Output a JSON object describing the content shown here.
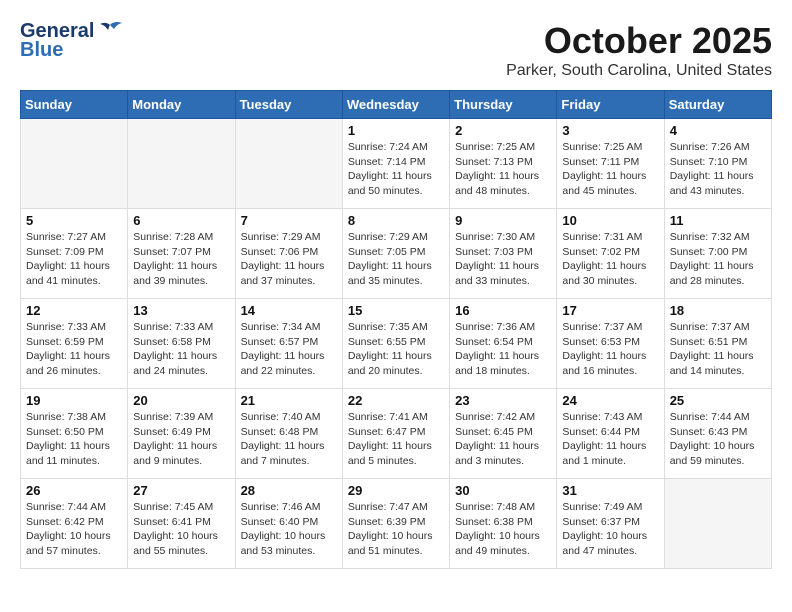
{
  "header": {
    "logo_line1": "General",
    "logo_line2": "Blue",
    "month": "October 2025",
    "location": "Parker, South Carolina, United States"
  },
  "days_of_week": [
    "Sunday",
    "Monday",
    "Tuesday",
    "Wednesday",
    "Thursday",
    "Friday",
    "Saturday"
  ],
  "weeks": [
    [
      {
        "day": "",
        "info": ""
      },
      {
        "day": "",
        "info": ""
      },
      {
        "day": "",
        "info": ""
      },
      {
        "day": "1",
        "info": "Sunrise: 7:24 AM\nSunset: 7:14 PM\nDaylight: 11 hours and 50 minutes."
      },
      {
        "day": "2",
        "info": "Sunrise: 7:25 AM\nSunset: 7:13 PM\nDaylight: 11 hours and 48 minutes."
      },
      {
        "day": "3",
        "info": "Sunrise: 7:25 AM\nSunset: 7:11 PM\nDaylight: 11 hours and 45 minutes."
      },
      {
        "day": "4",
        "info": "Sunrise: 7:26 AM\nSunset: 7:10 PM\nDaylight: 11 hours and 43 minutes."
      }
    ],
    [
      {
        "day": "5",
        "info": "Sunrise: 7:27 AM\nSunset: 7:09 PM\nDaylight: 11 hours and 41 minutes."
      },
      {
        "day": "6",
        "info": "Sunrise: 7:28 AM\nSunset: 7:07 PM\nDaylight: 11 hours and 39 minutes."
      },
      {
        "day": "7",
        "info": "Sunrise: 7:29 AM\nSunset: 7:06 PM\nDaylight: 11 hours and 37 minutes."
      },
      {
        "day": "8",
        "info": "Sunrise: 7:29 AM\nSunset: 7:05 PM\nDaylight: 11 hours and 35 minutes."
      },
      {
        "day": "9",
        "info": "Sunrise: 7:30 AM\nSunset: 7:03 PM\nDaylight: 11 hours and 33 minutes."
      },
      {
        "day": "10",
        "info": "Sunrise: 7:31 AM\nSunset: 7:02 PM\nDaylight: 11 hours and 30 minutes."
      },
      {
        "day": "11",
        "info": "Sunrise: 7:32 AM\nSunset: 7:00 PM\nDaylight: 11 hours and 28 minutes."
      }
    ],
    [
      {
        "day": "12",
        "info": "Sunrise: 7:33 AM\nSunset: 6:59 PM\nDaylight: 11 hours and 26 minutes."
      },
      {
        "day": "13",
        "info": "Sunrise: 7:33 AM\nSunset: 6:58 PM\nDaylight: 11 hours and 24 minutes."
      },
      {
        "day": "14",
        "info": "Sunrise: 7:34 AM\nSunset: 6:57 PM\nDaylight: 11 hours and 22 minutes."
      },
      {
        "day": "15",
        "info": "Sunrise: 7:35 AM\nSunset: 6:55 PM\nDaylight: 11 hours and 20 minutes."
      },
      {
        "day": "16",
        "info": "Sunrise: 7:36 AM\nSunset: 6:54 PM\nDaylight: 11 hours and 18 minutes."
      },
      {
        "day": "17",
        "info": "Sunrise: 7:37 AM\nSunset: 6:53 PM\nDaylight: 11 hours and 16 minutes."
      },
      {
        "day": "18",
        "info": "Sunrise: 7:37 AM\nSunset: 6:51 PM\nDaylight: 11 hours and 14 minutes."
      }
    ],
    [
      {
        "day": "19",
        "info": "Sunrise: 7:38 AM\nSunset: 6:50 PM\nDaylight: 11 hours and 11 minutes."
      },
      {
        "day": "20",
        "info": "Sunrise: 7:39 AM\nSunset: 6:49 PM\nDaylight: 11 hours and 9 minutes."
      },
      {
        "day": "21",
        "info": "Sunrise: 7:40 AM\nSunset: 6:48 PM\nDaylight: 11 hours and 7 minutes."
      },
      {
        "day": "22",
        "info": "Sunrise: 7:41 AM\nSunset: 6:47 PM\nDaylight: 11 hours and 5 minutes."
      },
      {
        "day": "23",
        "info": "Sunrise: 7:42 AM\nSunset: 6:45 PM\nDaylight: 11 hours and 3 minutes."
      },
      {
        "day": "24",
        "info": "Sunrise: 7:43 AM\nSunset: 6:44 PM\nDaylight: 11 hours and 1 minute."
      },
      {
        "day": "25",
        "info": "Sunrise: 7:44 AM\nSunset: 6:43 PM\nDaylight: 10 hours and 59 minutes."
      }
    ],
    [
      {
        "day": "26",
        "info": "Sunrise: 7:44 AM\nSunset: 6:42 PM\nDaylight: 10 hours and 57 minutes."
      },
      {
        "day": "27",
        "info": "Sunrise: 7:45 AM\nSunset: 6:41 PM\nDaylight: 10 hours and 55 minutes."
      },
      {
        "day": "28",
        "info": "Sunrise: 7:46 AM\nSunset: 6:40 PM\nDaylight: 10 hours and 53 minutes."
      },
      {
        "day": "29",
        "info": "Sunrise: 7:47 AM\nSunset: 6:39 PM\nDaylight: 10 hours and 51 minutes."
      },
      {
        "day": "30",
        "info": "Sunrise: 7:48 AM\nSunset: 6:38 PM\nDaylight: 10 hours and 49 minutes."
      },
      {
        "day": "31",
        "info": "Sunrise: 7:49 AM\nSunset: 6:37 PM\nDaylight: 10 hours and 47 minutes."
      },
      {
        "day": "",
        "info": ""
      }
    ]
  ]
}
